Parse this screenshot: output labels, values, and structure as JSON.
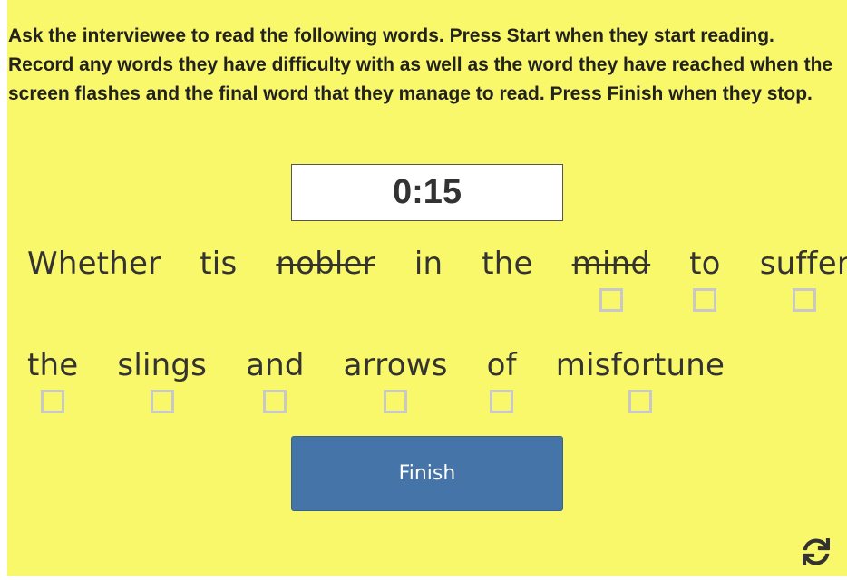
{
  "instructions": "Ask the interviewee to read the following words. Press Start when they start reading. Record any words they have difficulty with as well as the word they have reached when the screen flashes and the final word that they manage to read. Press Finish when they stop.",
  "timer": "0:15",
  "rows": [
    [
      {
        "text": "Whether",
        "struck": false,
        "checkbox": false
      },
      {
        "text": "tis",
        "struck": false,
        "checkbox": false
      },
      {
        "text": "nobler",
        "struck": true,
        "checkbox": false
      },
      {
        "text": "in",
        "struck": false,
        "checkbox": false
      },
      {
        "text": "the",
        "struck": false,
        "checkbox": false
      },
      {
        "text": "mind",
        "struck": true,
        "checkbox": true
      },
      {
        "text": "to",
        "struck": false,
        "checkbox": true
      },
      {
        "text": "suffer",
        "struck": false,
        "checkbox": true
      }
    ],
    [
      {
        "text": "the",
        "struck": false,
        "checkbox": true
      },
      {
        "text": "slings",
        "struck": false,
        "checkbox": true
      },
      {
        "text": "and",
        "struck": false,
        "checkbox": true
      },
      {
        "text": "arrows",
        "struck": false,
        "checkbox": true
      },
      {
        "text": "of",
        "struck": false,
        "checkbox": true
      },
      {
        "text": "misfortune",
        "struck": false,
        "checkbox": true
      }
    ]
  ],
  "finish_label": "Finish",
  "icons": {
    "reset": "refresh-icon"
  },
  "colors": {
    "background": "#f9f76a",
    "button": "#4574a8",
    "checkbox_border": "#c8c8c8"
  }
}
